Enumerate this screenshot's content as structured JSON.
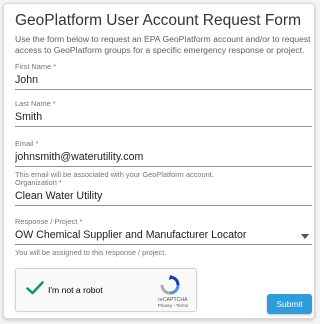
{
  "form": {
    "title": "GeoPlatform User Account Request Form",
    "intro": "Use the form below to request an EPA GeoPlatform account and/or to request access to GeoPlatform groups for a specific emergency response or project.",
    "fields": {
      "first_name": {
        "label": "First Name *",
        "value": "John"
      },
      "last_name": {
        "label": "Last Name *",
        "value": "Smith"
      },
      "email": {
        "label": "Email *",
        "value": "johnsmith@waterutility.com",
        "helper": "This email will be associated with your GeoPlatform account."
      },
      "organization": {
        "label": "Organization *",
        "value": "Clean Water Utility"
      },
      "response_project": {
        "label": "Response / Project *",
        "value": "OW Chemical Supplier and Manufacturer Locator",
        "helper": "You will be assigned to this response / project."
      }
    },
    "captcha": {
      "label": "I'm not a robot",
      "brand": "reCAPTCHA",
      "links": "Privacy - Terms",
      "checked": true
    },
    "submit_label": "Submit"
  },
  "colors": {
    "accent": "#2d9cdb",
    "check": "#009e55"
  }
}
